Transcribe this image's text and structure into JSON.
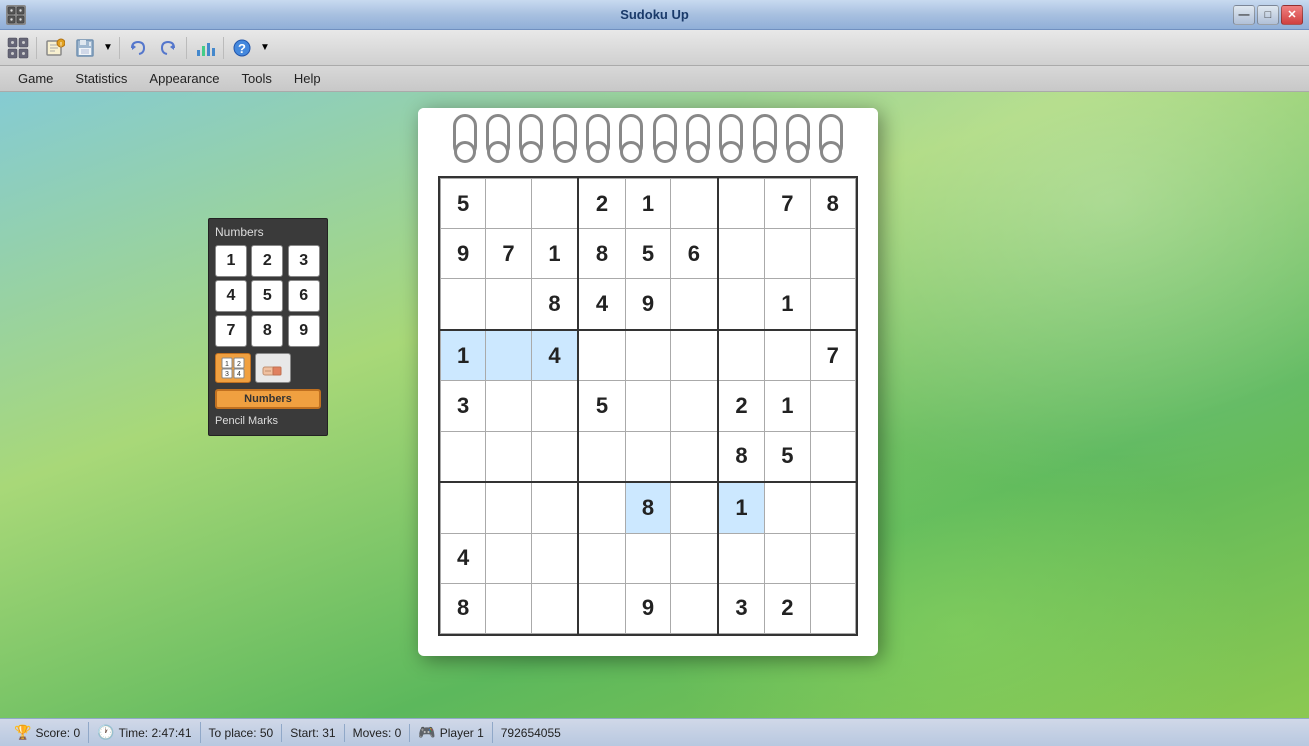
{
  "window": {
    "title": "Sudoku Up",
    "app_icon": "🎲"
  },
  "titlebar": {
    "minimize": "—",
    "maximize": "□",
    "close": "✕"
  },
  "toolbar": {
    "icons": [
      "🎲",
      "📄",
      "📋",
      "↩",
      "↪",
      "📊",
      "❓",
      "▼"
    ]
  },
  "menubar": {
    "items": [
      "Game",
      "Statistics",
      "Appearance",
      "Tools",
      "Help"
    ]
  },
  "numbers_panel": {
    "title": "Numbers",
    "numbers": [
      "1",
      "2",
      "3",
      "4",
      "5",
      "6",
      "7",
      "8",
      "9"
    ],
    "mode_numbers": "Numbers",
    "mode_pencil": "Pencil Marks"
  },
  "sudoku": {
    "grid": [
      [
        {
          "v": "5",
          "h": false
        },
        {
          "v": "",
          "h": false
        },
        {
          "v": "",
          "h": false
        },
        {
          "v": "2",
          "h": false
        },
        {
          "v": "1",
          "h": false
        },
        {
          "v": "",
          "h": false
        },
        {
          "v": "",
          "h": false
        },
        {
          "v": "7",
          "h": false
        },
        {
          "v": "8",
          "h": false
        }
      ],
      [
        {
          "v": "9",
          "h": false
        },
        {
          "v": "7",
          "h": false
        },
        {
          "v": "1",
          "h": false
        },
        {
          "v": "8",
          "h": false
        },
        {
          "v": "5",
          "h": false
        },
        {
          "v": "6",
          "h": false
        },
        {
          "v": "",
          "h": false
        },
        {
          "v": "",
          "h": false
        },
        {
          "v": "",
          "h": false
        }
      ],
      [
        {
          "v": "",
          "h": false
        },
        {
          "v": "",
          "h": false
        },
        {
          "v": "8",
          "h": false
        },
        {
          "v": "4",
          "h": false
        },
        {
          "v": "9",
          "h": false
        },
        {
          "v": "",
          "h": false
        },
        {
          "v": "",
          "h": false
        },
        {
          "v": "1",
          "h": false
        },
        {
          "v": "",
          "h": false
        }
      ],
      [
        {
          "v": "1",
          "h": true
        },
        {
          "v": "",
          "h": true
        },
        {
          "v": "4",
          "h": true
        },
        {
          "v": "",
          "h": false
        },
        {
          "v": "",
          "h": false
        },
        {
          "v": "",
          "h": false
        },
        {
          "v": "",
          "h": false
        },
        {
          "v": "",
          "h": false
        },
        {
          "v": "7",
          "h": false
        }
      ],
      [
        {
          "v": "3",
          "h": false
        },
        {
          "v": "",
          "h": false
        },
        {
          "v": "",
          "h": false
        },
        {
          "v": "5",
          "h": false
        },
        {
          "v": "",
          "h": false
        },
        {
          "v": "",
          "h": false
        },
        {
          "v": "2",
          "h": false
        },
        {
          "v": "1",
          "h": false
        },
        {
          "v": "",
          "h": false
        }
      ],
      [
        {
          "v": "",
          "h": false
        },
        {
          "v": "",
          "h": false
        },
        {
          "v": "",
          "h": false
        },
        {
          "v": "",
          "h": false
        },
        {
          "v": "",
          "h": false
        },
        {
          "v": "",
          "h": false
        },
        {
          "v": "8",
          "h": false
        },
        {
          "v": "5",
          "h": false
        },
        {
          "v": "",
          "h": false
        }
      ],
      [
        {
          "v": "",
          "h": false
        },
        {
          "v": "",
          "h": false
        },
        {
          "v": "",
          "h": false
        },
        {
          "v": "",
          "h": false
        },
        {
          "v": "8",
          "h": true
        },
        {
          "v": "",
          "h": false
        },
        {
          "v": "1",
          "h": true
        },
        {
          "v": "",
          "h": false
        },
        {
          "v": "",
          "h": false
        }
      ],
      [
        {
          "v": "4",
          "h": false
        },
        {
          "v": "",
          "h": false
        },
        {
          "v": "",
          "h": false
        },
        {
          "v": "",
          "h": false
        },
        {
          "v": "",
          "h": false
        },
        {
          "v": "",
          "h": false
        },
        {
          "v": "",
          "h": false
        },
        {
          "v": "",
          "h": false
        },
        {
          "v": "",
          "h": false
        }
      ],
      [
        {
          "v": "8",
          "h": false
        },
        {
          "v": "",
          "h": false
        },
        {
          "v": "",
          "h": false
        },
        {
          "v": "",
          "h": false
        },
        {
          "v": "9",
          "h": false
        },
        {
          "v": "",
          "h": false
        },
        {
          "v": "3",
          "h": false
        },
        {
          "v": "2",
          "h": false
        },
        {
          "v": "",
          "h": false
        }
      ]
    ]
  },
  "statusbar": {
    "score": "Score: 0",
    "time": "Time: 2:47:41",
    "to_place": "To place: 50",
    "start": "Start: 31",
    "moves": "Moves: 0",
    "player": "Player 1",
    "game_id": "792654055"
  }
}
